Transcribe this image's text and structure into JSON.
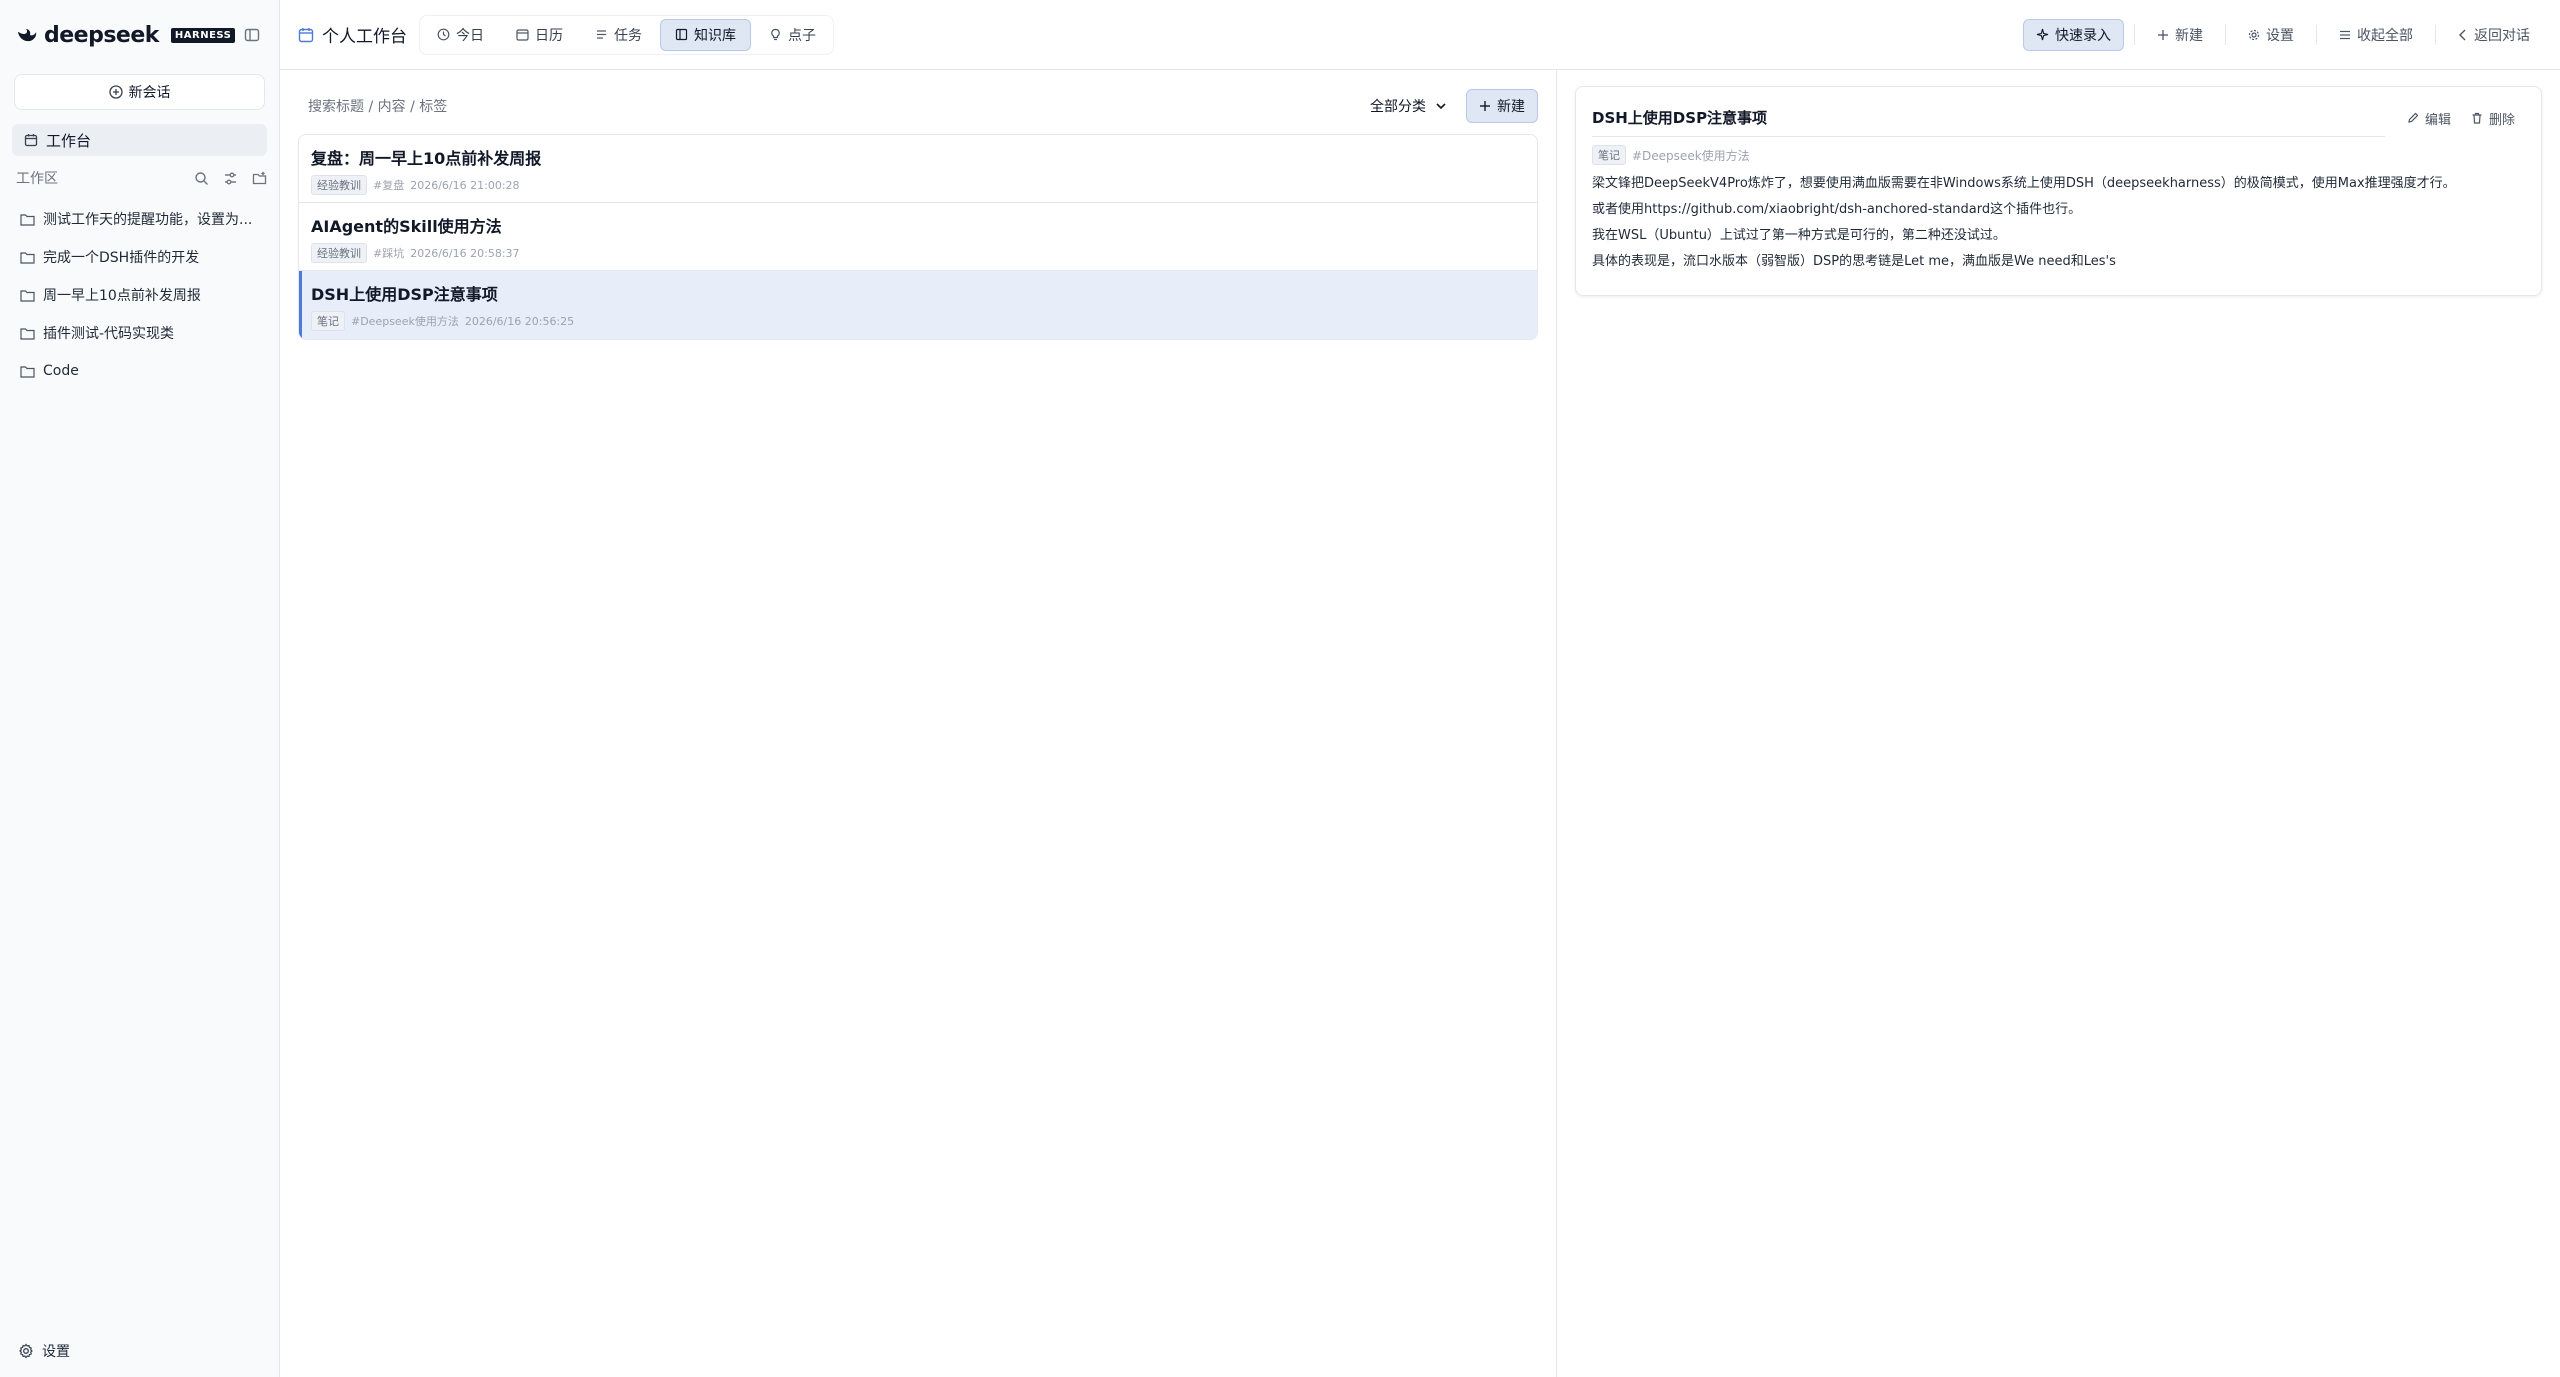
{
  "brand": {
    "name": "deepseek",
    "badge": "HARNESS"
  },
  "sidebar": {
    "new_chat": "新会话",
    "workbench": "工作台",
    "workspace_title": "工作区",
    "workspace_items": [
      {
        "label": "测试工作天的提醒功能，设置为..."
      },
      {
        "label": "完成一个DSH插件的开发"
      },
      {
        "label": "周一早上10点前补发周报"
      },
      {
        "label": "插件测试-代码实现类"
      },
      {
        "label": "Code"
      }
    ],
    "settings": "设置"
  },
  "header": {
    "title": "个人工作台",
    "tabs": [
      {
        "label": "今日",
        "icon": "clock-icon"
      },
      {
        "label": "日历",
        "icon": "calendar-icon"
      },
      {
        "label": "任务",
        "icon": "list-icon"
      },
      {
        "label": "知识库",
        "icon": "book-icon"
      },
      {
        "label": "点子",
        "icon": "lightbulb-icon"
      }
    ],
    "actions": {
      "quick_entry": "快速录入",
      "new": "新建",
      "settings": "设置",
      "collapse_all": "收起全部",
      "back": "返回对话"
    }
  },
  "list": {
    "search_placeholder": "搜索标题 / 内容 / 标签",
    "category": "全部分类",
    "new_button": "新建",
    "notes": [
      {
        "title": "复盘：周一早上10点前补发周报",
        "tag": "经验教训",
        "hashtag": "#复盘",
        "time": "2026/6/16 21:00:28"
      },
      {
        "title": "AIAgent的Skill使用方法",
        "tag": "经验教训",
        "hashtag": "#踩坑",
        "time": "2026/6/16 20:58:37"
      },
      {
        "title": "DSH上使用DSP注意事项",
        "tag": "笔记",
        "hashtag": "#Deepseek使用方法",
        "time": "2026/6/16 20:56:25"
      }
    ]
  },
  "detail": {
    "title": "DSH上使用DSP注意事项",
    "edit": "编辑",
    "delete": "删除",
    "tag": "笔记",
    "hashtag": "#Deepseek使用方法",
    "lines": [
      "梁文锋把DeepSeekV4Pro炼炸了，想要使用满血版需要在非Windows系统上使用DSH（deepseekharness）的极简模式，使用Max推理强度才行。",
      "或者使用https://github.com/xiaobright/dsh-anchored-standard这个插件也行。",
      "我在WSL（Ubuntu）上试过了第一种方式是可行的，第二种还没试过。",
      "具体的表现是，流口水版本（弱智版）DSP的思考链是Let me，满血版是We need和Les's"
    ]
  },
  "colors": {
    "accent": "#4c7bd9",
    "active_bg": "#dfe7f5",
    "sidebar_bg": "#f9fafb"
  }
}
